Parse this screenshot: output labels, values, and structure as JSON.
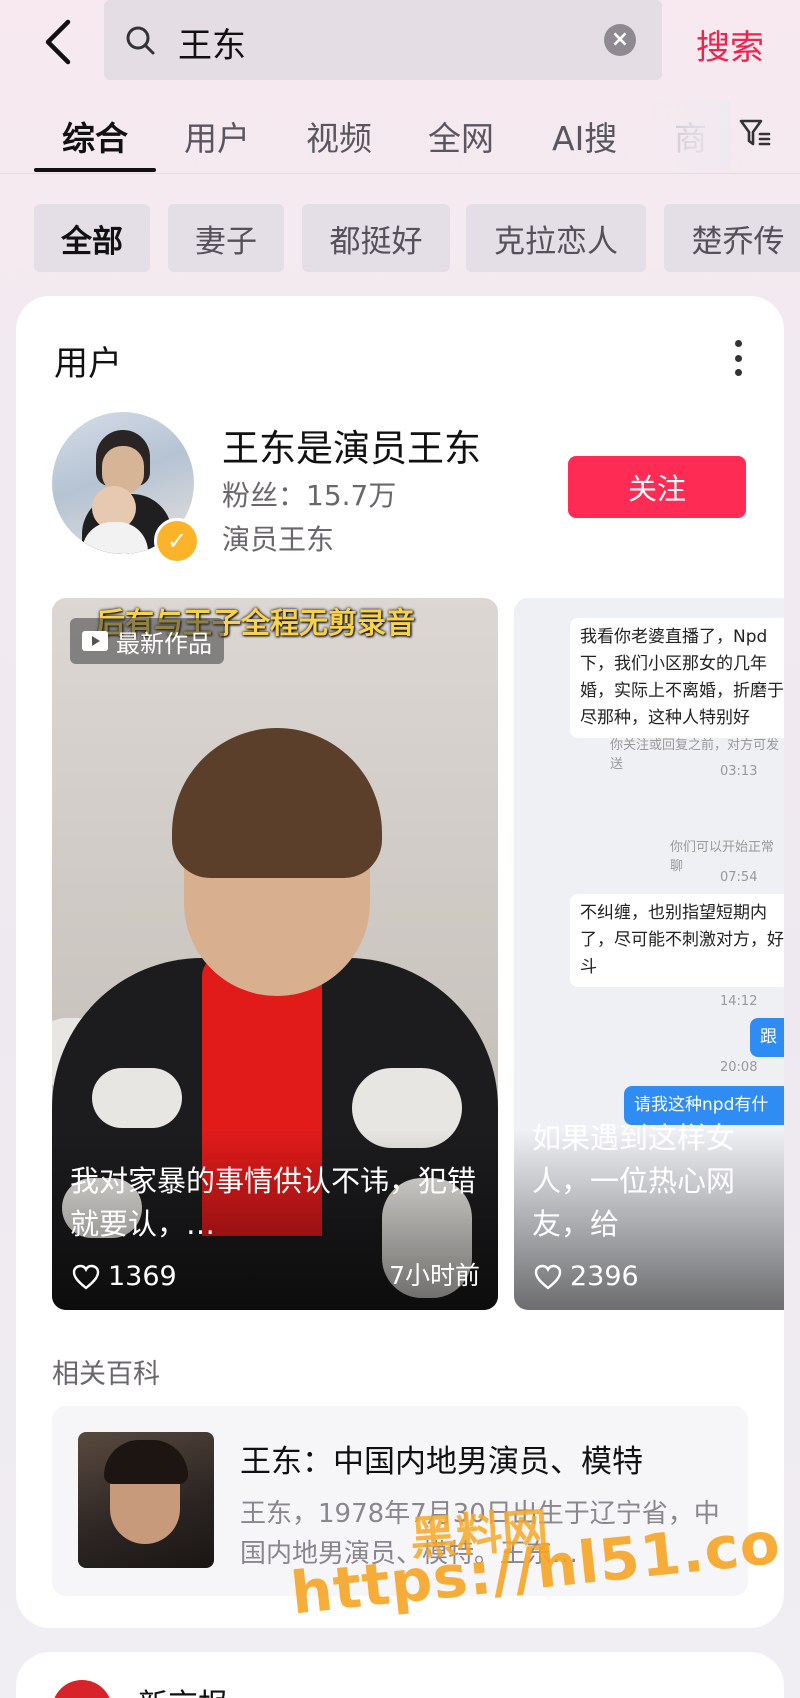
{
  "search": {
    "query": "王东",
    "button_label": "搜索"
  },
  "tabs": [
    {
      "label": "综合"
    },
    {
      "label": "用户"
    },
    {
      "label": "视频"
    },
    {
      "label": "全网"
    },
    {
      "label": "AI搜"
    },
    {
      "label": "商"
    }
  ],
  "chips": [
    {
      "label": "全部"
    },
    {
      "label": "妻子"
    },
    {
      "label": "都挺好"
    },
    {
      "label": "克拉恋人"
    },
    {
      "label": "楚乔传"
    }
  ],
  "user_section": {
    "title": "用户",
    "name": "王东是演员王东",
    "fans": "粉丝：15.7万",
    "desc": "演员王东",
    "follow_label": "关注"
  },
  "videos": [
    {
      "badge": "最新作品",
      "top_caption": "后有与王子全程无剪录音",
      "title": "我对家暴的事情供认不讳，犯错就要认，…",
      "likes": "1369",
      "time": "7小时前"
    },
    {
      "title": "如果遇到这样女人，一位热心网友，给",
      "likes": "2396",
      "chat": {
        "msg1": "我看你老婆直播了，Npd下，我们小区那女的几年婚，实际上不离婚，折磨于尽那种，这种人特别好",
        "note1": "你关注或回复之前，对方可发送",
        "time1": "03:13",
        "note2": "你们可以开始正常聊",
        "time2": "07:54",
        "msg2": "不纠缠，也别指望短期内了，尽可能不刺激对方，好斗",
        "time3": "14:12",
        "me1": "跟",
        "time4": "20:08",
        "me2": "请我这种npd有什"
      }
    }
  ],
  "baike": {
    "label": "相关百科",
    "title": "王东：中国内地男演员、模特",
    "desc": "王东，1978年7月30日出生于辽宁省，中国内地男演员、模特。王东…"
  },
  "next_card": {
    "title": "新京报"
  },
  "watermark": {
    "cn": "黑料网",
    "url": "https://hl51.co"
  },
  "colors": {
    "accent": "#fe2c55",
    "search_button": "#f0224e",
    "verified": "#fbb32a"
  }
}
